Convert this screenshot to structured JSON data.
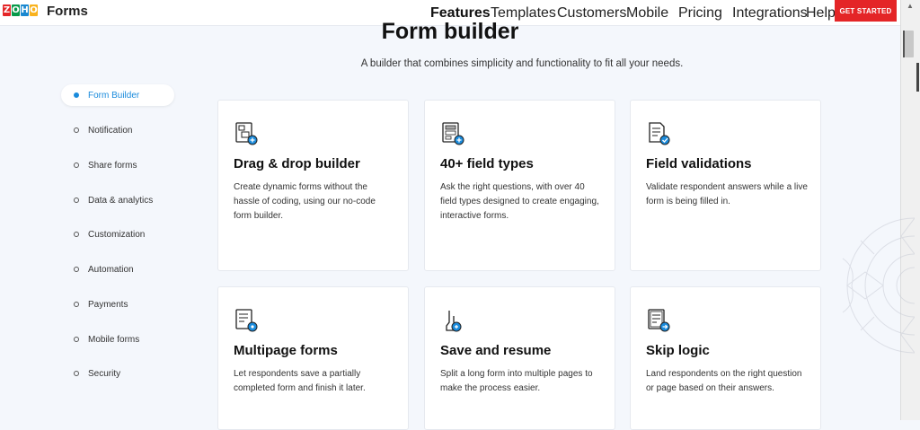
{
  "header": {
    "logo_letters": [
      "Z",
      "O",
      "H",
      "O"
    ],
    "logo_colors": [
      "#e42527",
      "#089949",
      "#1b88d0",
      "#f9b21d"
    ],
    "brand": "Forms",
    "nav": [
      "Features",
      "Templates",
      "Customers",
      "Mobile",
      "Pricing",
      "Integrations",
      "Help"
    ],
    "active_nav": "Features",
    "cta": "GET STARTED"
  },
  "hero": {
    "title": "Form builder",
    "subtitle": "A builder that combines simplicity and functionality to fit all your needs."
  },
  "sidebar": {
    "items": [
      "Form Builder",
      "Notification",
      "Share forms",
      "Data & analytics",
      "Customization",
      "Automation",
      "Payments",
      "Mobile forms",
      "Security"
    ],
    "active": "Form Builder"
  },
  "cards": [
    {
      "icon": "drag-drop-icon",
      "title": "Drag & drop builder",
      "desc": "Create dynamic forms without the hassle of coding, using our no-code form builder."
    },
    {
      "icon": "field-types-icon",
      "title": "40+ field types",
      "desc": "Ask the right questions, with over 40 field types designed to create engaging, interactive forms."
    },
    {
      "icon": "validation-icon",
      "title": "Field validations",
      "desc": "Validate respondent answers while a live form is being filled in."
    },
    {
      "icon": "multipage-icon",
      "title": "Multipage forms",
      "desc": "Let respondents save a partially completed form and finish it later."
    },
    {
      "icon": "save-resume-icon",
      "title": "Save and resume",
      "desc": "Split a long form into multiple pages to make the process easier."
    },
    {
      "icon": "skip-logic-icon",
      "title": "Skip logic",
      "desc": "Land respondents on the right question or page based on their answers."
    }
  ],
  "colors": {
    "accent": "#1a8bdc",
    "cta": "#e42527"
  }
}
